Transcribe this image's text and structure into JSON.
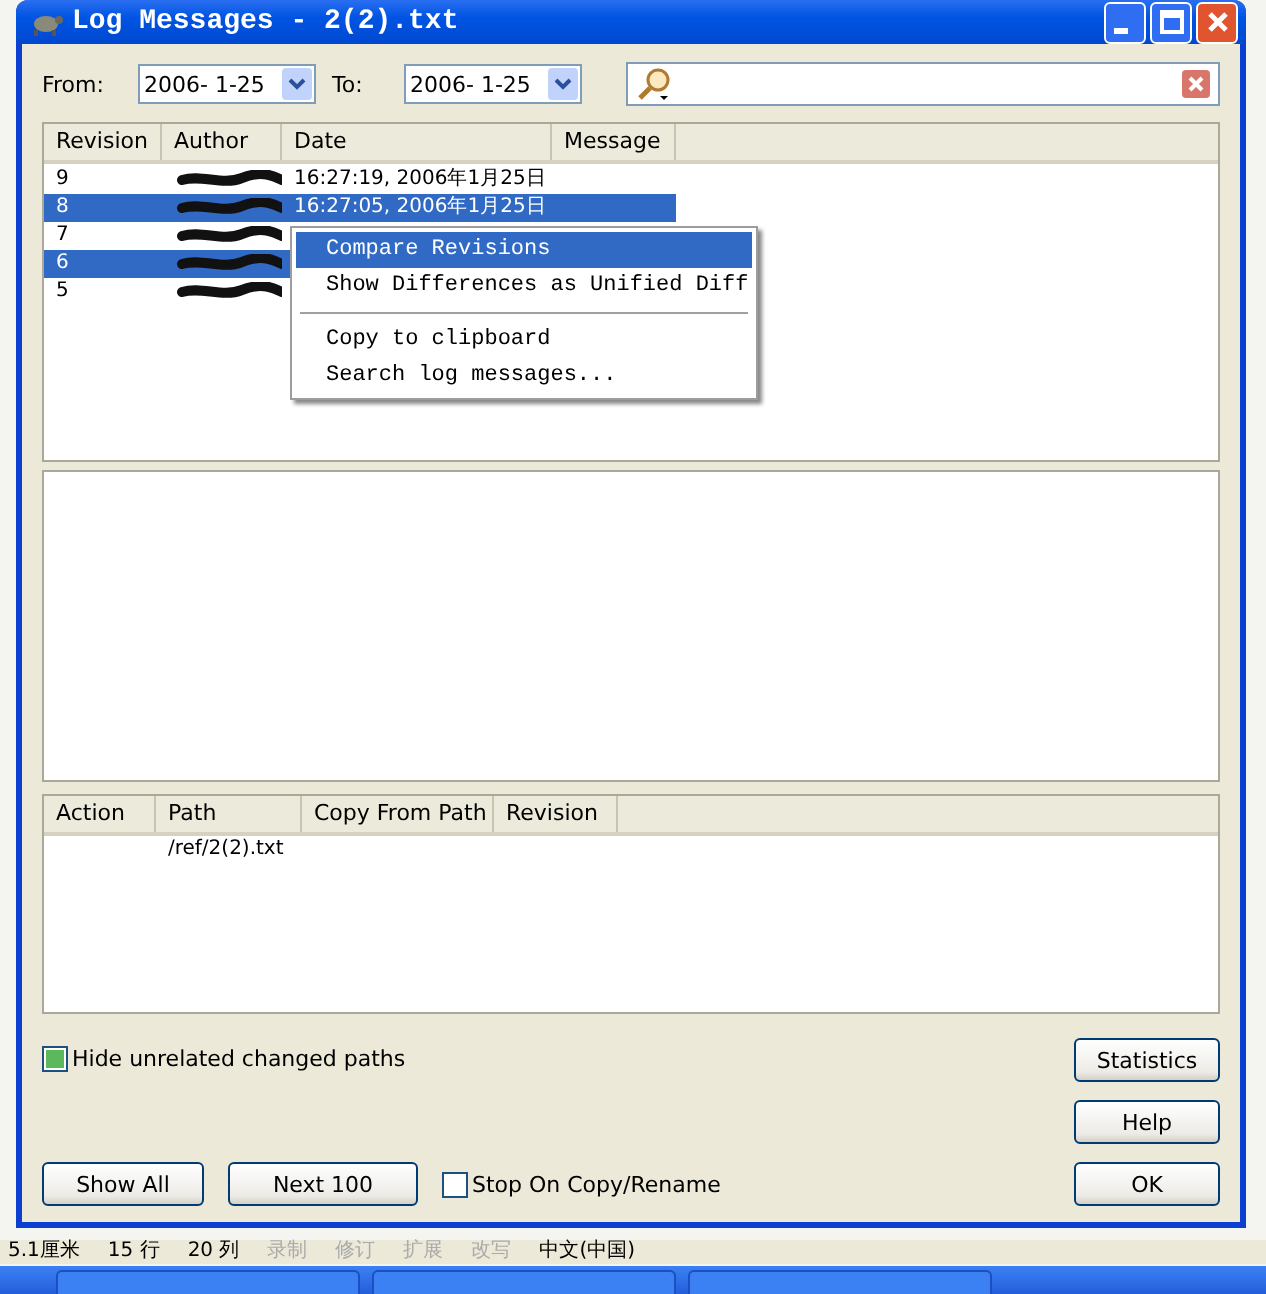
{
  "window": {
    "title": "Log Messages - 2(2).txt"
  },
  "filters": {
    "from_label": "From:",
    "from_value": "2006- 1-25",
    "to_label": "To:",
    "to_value": "2006- 1-25"
  },
  "log": {
    "columns": [
      "Revision",
      "Author",
      "Date",
      "Message"
    ],
    "rows": [
      {
        "revision": "9",
        "date": "16:27:19, 2006年1月25日",
        "selected": false
      },
      {
        "revision": "8",
        "date": "16:27:05, 2006年1月25日",
        "selected": true
      },
      {
        "revision": "7",
        "selected": false
      },
      {
        "revision": "6",
        "selected": true
      },
      {
        "revision": "5",
        "selected": false
      }
    ]
  },
  "context_menu": {
    "items": [
      {
        "kind": "item",
        "label": "Compare Revisions",
        "selected": true
      },
      {
        "kind": "item",
        "label": "Show Differences as Unified Diff",
        "selected": false
      },
      {
        "kind": "separator"
      },
      {
        "kind": "item",
        "label": "Copy to clipboard",
        "selected": false
      },
      {
        "kind": "item",
        "label": "Search log messages...",
        "selected": false
      }
    ]
  },
  "paths": {
    "columns": [
      "Action",
      "Path",
      "Copy From Path",
      "Revision"
    ],
    "rows": [
      {
        "path": "/ref/2(2).txt"
      }
    ]
  },
  "hide_unrelated": {
    "label": "Hide unrelated changed paths",
    "checked": true
  },
  "stop_on_copy": {
    "label": "Stop On Copy/Rename",
    "checked": false
  },
  "buttons": {
    "statistics": "Statistics",
    "help": "Help",
    "ok": "OK",
    "show_all": "Show All",
    "next": "Next 100"
  },
  "status_bar": [
    {
      "text": "5.1厘米",
      "disabled": false
    },
    {
      "text": "15 行",
      "disabled": false
    },
    {
      "text": "20 列",
      "disabled": false
    },
    {
      "text": "录制",
      "disabled": true
    },
    {
      "text": "修订",
      "disabled": true
    },
    {
      "text": "扩展",
      "disabled": true
    },
    {
      "text": "改写",
      "disabled": true
    },
    {
      "text": "中文(中国)",
      "disabled": false
    }
  ]
}
